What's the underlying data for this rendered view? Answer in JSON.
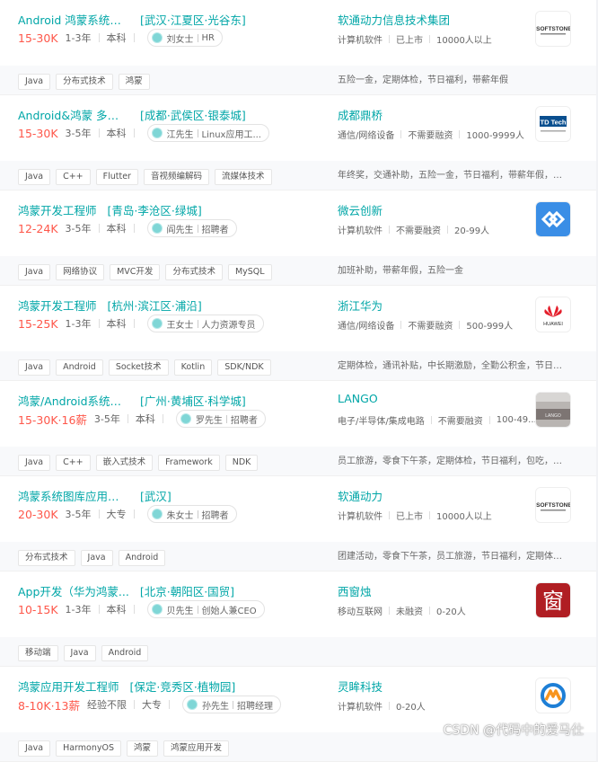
{
  "jobs": [
    {
      "title": "Android 鸿蒙系统图...",
      "city": "[武汉·江夏区·光谷东]",
      "salary": "15-30K",
      "experience": "1-3年",
      "education": "本科",
      "recruiter": "刘女士",
      "recruiter_role": "HR",
      "company": "软通动力信息技术集团",
      "company_info": [
        "计算机软件",
        "已上市",
        "10000人以上"
      ],
      "logo": "isoftstone-logo",
      "tags": [
        "Java",
        "分布式技术",
        "鸿蒙"
      ],
      "welfare": "五险一金，定期体检，节日福利，带薪年假"
    },
    {
      "title": "Android&鸿蒙 多媒体...",
      "city": "[成都·武侯区·银泰城]",
      "salary": "15-30K",
      "experience": "3-5年",
      "education": "本科",
      "recruiter": "江先生",
      "recruiter_role": "Linux应用工...",
      "company": "成都鼎桥",
      "company_info": [
        "通信/网络设备",
        "不需要融资",
        "1000-9999人"
      ],
      "logo": "td-tech-logo",
      "tags": [
        "Java",
        "C++",
        "Flutter",
        "音视频编解码",
        "流媒体技术"
      ],
      "welfare": "年终奖，交通补助，五险一金，节日福利，带薪年假，加..."
    },
    {
      "title": "鸿蒙开发工程师",
      "city": "[青岛·李沧区·绿城]",
      "salary": "12-24K",
      "experience": "3-5年",
      "education": "本科",
      "recruiter": "阎先生",
      "recruiter_role": "招聘者",
      "company": "微云创新",
      "company_info": [
        "计算机软件",
        "不需要融资",
        "20-99人"
      ],
      "logo": "weiyun-logo",
      "tags": [
        "Java",
        "网络协议",
        "MVC开发",
        "分布式技术",
        "MySQL"
      ],
      "welfare": "加班补助，带薪年假，五险一金"
    },
    {
      "title": "鸿蒙开发工程师",
      "city": "[杭州·滨江区·浦沿]",
      "salary": "15-25K",
      "experience": "1-3年",
      "education": "本科",
      "recruiter": "王女士",
      "recruiter_role": "人力资源专员",
      "company": "浙江华为",
      "company_info": [
        "通信/网络设备",
        "不需要融资",
        "500-999人"
      ],
      "logo": "huawei-logo",
      "tags": [
        "Java",
        "Android",
        "Socket技术",
        "Kotlin",
        "SDK/NDK"
      ],
      "welfare": "定期体检，通讯补贴，中长期激励，全勤公积金，节日福..."
    },
    {
      "title": "鸿蒙/Android系统开...",
      "city": "[广州·黄埔区·科学城]",
      "salary": "15-30K·16薪",
      "experience": "3-5年",
      "education": "本科",
      "recruiter": "罗先生",
      "recruiter_role": "招聘者",
      "company": "LANGO",
      "company_info": [
        "电子/半导体/集成电路",
        "不需要融资",
        "100-49..."
      ],
      "logo": "lango-logo",
      "tags": [
        "Java",
        "C++",
        "嵌入式技术",
        "Framework",
        "NDK"
      ],
      "welfare": "员工旅游，零食下午茶，定期体检，节日福利，包吃，加..."
    },
    {
      "title": "鸿蒙系统图库应用开...",
      "city": "[武汉]",
      "salary": "20-30K",
      "experience": "3-5年",
      "education": "大专",
      "recruiter": "朱女士",
      "recruiter_role": "招聘者",
      "company": "软通动力",
      "company_info": [
        "计算机软件",
        "已上市",
        "10000人以上"
      ],
      "logo": "isoftstone-logo",
      "tags": [
        "分布式技术",
        "Java",
        "Android"
      ],
      "welfare": "团建活动，零食下午茶，员工旅游，节日福利，定期体检..."
    },
    {
      "title": "App开发（华为鸿蒙...",
      "city": "[北京·朝阳区·国贸]",
      "salary": "10-15K",
      "experience": "1-3年",
      "education": "本科",
      "recruiter": "贝先生",
      "recruiter_role": "创始人兼CEO",
      "company": "西窗烛",
      "company_info": [
        "移动互联网",
        "未融资",
        "0-20人"
      ],
      "logo": "xichuangzhu-logo",
      "logo_char": "窗",
      "tags": [
        "移动端",
        "Java",
        "Android"
      ],
      "welfare": ""
    },
    {
      "title": "鸿蒙应用开发工程师",
      "city": "[保定·竞秀区·植物园]",
      "salary": "8-10K·13薪",
      "experience": "经验不限",
      "education": "大专",
      "recruiter": "孙先生",
      "recruiter_role": "招聘经理",
      "company": "灵眸科技",
      "company_info": [
        "计算机软件",
        "0-20人"
      ],
      "logo": "lingmou-logo",
      "tags": [
        "Java",
        "HarmonyOS",
        "鸿蒙",
        "鸿蒙应用开发"
      ],
      "welfare": ""
    }
  ],
  "watermark": "CSDN @代码中的爱马仕",
  "colors": {
    "accent": "#00a6a7",
    "salary": "#fe574a"
  }
}
